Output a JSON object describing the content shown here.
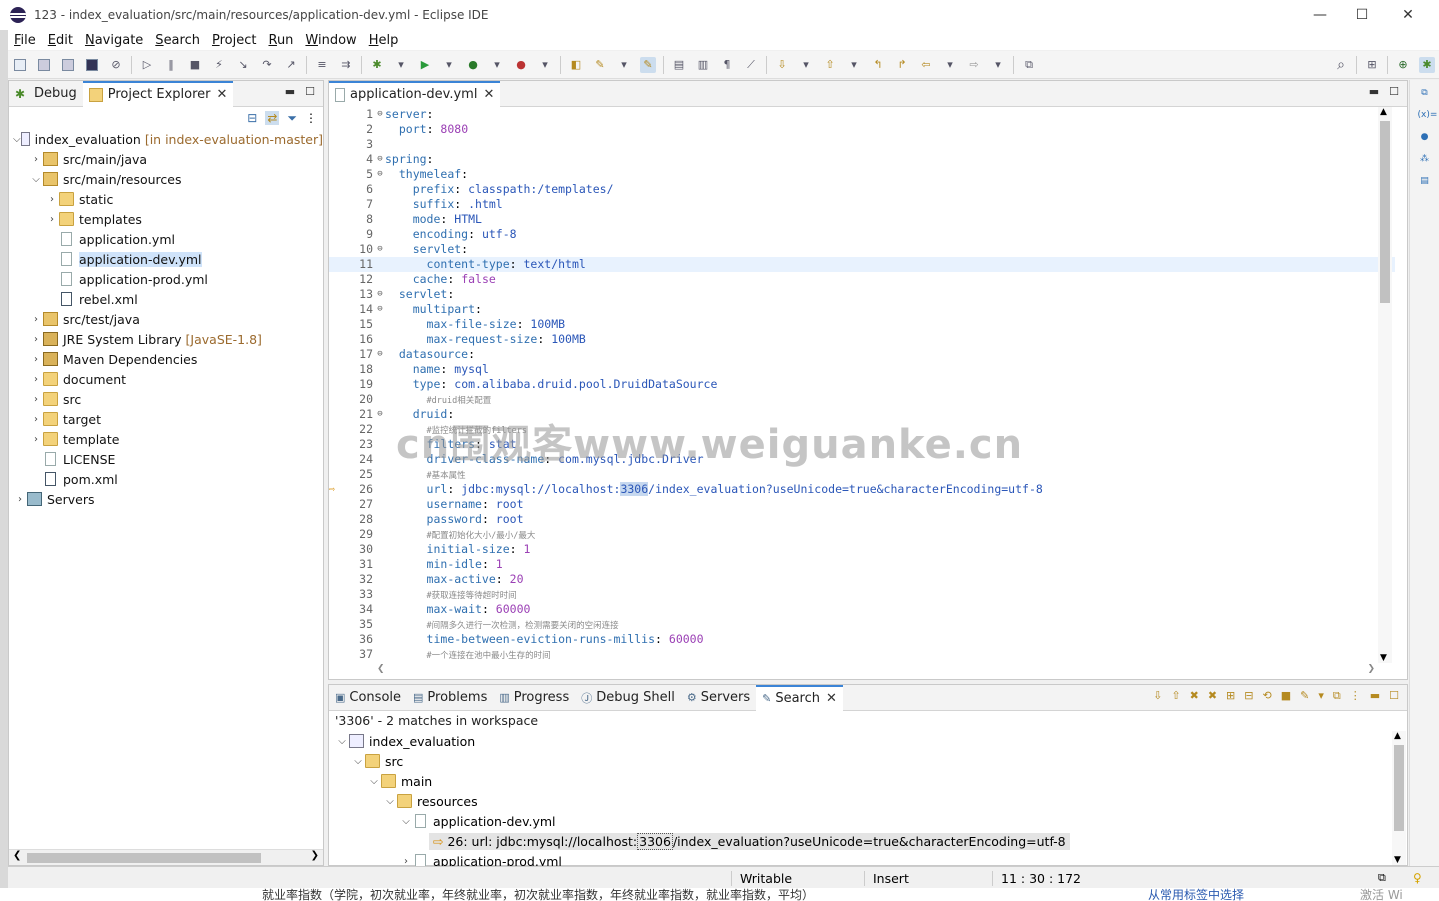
{
  "window": {
    "title": "123 - index_evaluation/src/main/resources/application-dev.yml - Eclipse IDE",
    "minimize": "—",
    "maximize": "☐",
    "close": "✕"
  },
  "menu": [
    "File",
    "Edit",
    "Navigate",
    "Search",
    "Project",
    "Run",
    "Window",
    "Help"
  ],
  "left_tabs": {
    "debug": "Debug",
    "explorer": "Project Explorer"
  },
  "tree": [
    {
      "label": "index_evaluation",
      "suffix": "[in index-evaluation-master]",
      "level": 0,
      "arrow": "v",
      "icon": "proj"
    },
    {
      "label": "src/main/java",
      "level": 1,
      "arrow": ">",
      "icon": "pkg"
    },
    {
      "label": "src/main/resources",
      "level": 1,
      "arrow": "v",
      "icon": "pkg"
    },
    {
      "label": "static",
      "level": 2,
      "arrow": ">",
      "icon": "folder"
    },
    {
      "label": "templates",
      "level": 2,
      "arrow": ">",
      "icon": "folder"
    },
    {
      "label": "application.yml",
      "level": 2,
      "arrow": "",
      "icon": "file"
    },
    {
      "label": "application-dev.yml",
      "level": 2,
      "arrow": "",
      "icon": "file",
      "selected": true
    },
    {
      "label": "application-prod.yml",
      "level": 2,
      "arrow": "",
      "icon": "file"
    },
    {
      "label": "rebel.xml",
      "level": 2,
      "arrow": "",
      "icon": "xml"
    },
    {
      "label": "src/test/java",
      "level": 1,
      "arrow": ">",
      "icon": "pkg"
    },
    {
      "label": "JRE System Library",
      "suffix": "[JavaSE-1.8]",
      "level": 1,
      "arrow": ">",
      "icon": "lib"
    },
    {
      "label": "Maven Dependencies",
      "level": 1,
      "arrow": ">",
      "icon": "lib"
    },
    {
      "label": "document",
      "level": 1,
      "arrow": ">",
      "icon": "folder"
    },
    {
      "label": "src",
      "level": 1,
      "arrow": ">",
      "icon": "folder"
    },
    {
      "label": "target",
      "level": 1,
      "arrow": ">",
      "icon": "folder"
    },
    {
      "label": "template",
      "level": 1,
      "arrow": ">",
      "icon": "folder"
    },
    {
      "label": "LICENSE",
      "level": 1,
      "arrow": "",
      "icon": "file"
    },
    {
      "label": "pom.xml",
      "level": 1,
      "arrow": "",
      "icon": "xml"
    },
    {
      "label": "Servers",
      "level": 0,
      "arrow": ">",
      "icon": "srv"
    }
  ],
  "editor": {
    "tab": "application-dev.yml",
    "highlight_line": 11,
    "lines": [
      {
        "n": "1",
        "f": "⊖",
        "t": [
          [
            "k",
            "server"
          ],
          [
            "p",
            ":"
          ]
        ]
      },
      {
        "n": "2",
        "t": [
          [
            "p",
            "  "
          ],
          [
            "k",
            "port"
          ],
          [
            "p",
            ": "
          ],
          [
            "n",
            "8080"
          ]
        ]
      },
      {
        "n": "3",
        "t": []
      },
      {
        "n": "4",
        "f": "⊖",
        "t": [
          [
            "k",
            "spring"
          ],
          [
            "p",
            ":"
          ]
        ]
      },
      {
        "n": "5",
        "f": "⊖",
        "t": [
          [
            "p",
            "  "
          ],
          [
            "k",
            "thymeleaf"
          ],
          [
            "p",
            ":"
          ]
        ]
      },
      {
        "n": "6",
        "t": [
          [
            "p",
            "    "
          ],
          [
            "k",
            "prefix"
          ],
          [
            "p",
            ": "
          ],
          [
            "v",
            "classpath:/templates/"
          ]
        ]
      },
      {
        "n": "7",
        "t": [
          [
            "p",
            "    "
          ],
          [
            "k",
            "suffix"
          ],
          [
            "p",
            ": "
          ],
          [
            "v",
            ".html"
          ]
        ]
      },
      {
        "n": "8",
        "t": [
          [
            "p",
            "    "
          ],
          [
            "k",
            "mode"
          ],
          [
            "p",
            ": "
          ],
          [
            "v",
            "HTML"
          ]
        ]
      },
      {
        "n": "9",
        "t": [
          [
            "p",
            "    "
          ],
          [
            "k",
            "encoding"
          ],
          [
            "p",
            ": "
          ],
          [
            "v",
            "utf-8"
          ]
        ]
      },
      {
        "n": "10",
        "f": "⊖",
        "t": [
          [
            "p",
            "    "
          ],
          [
            "k",
            "servlet"
          ],
          [
            "p",
            ":"
          ]
        ]
      },
      {
        "n": "11",
        "t": [
          [
            "p",
            "      "
          ],
          [
            "k",
            "content-type"
          ],
          [
            "p",
            ": "
          ],
          [
            "v",
            "text/html"
          ]
        ]
      },
      {
        "n": "12",
        "t": [
          [
            "p",
            "    "
          ],
          [
            "k",
            "cache"
          ],
          [
            "p",
            ": "
          ],
          [
            "n",
            "false"
          ]
        ]
      },
      {
        "n": "13",
        "f": "⊖",
        "t": [
          [
            "p",
            "  "
          ],
          [
            "k",
            "servlet"
          ],
          [
            "p",
            ":"
          ]
        ]
      },
      {
        "n": "14",
        "f": "⊖",
        "t": [
          [
            "p",
            "    "
          ],
          [
            "k",
            "multipart"
          ],
          [
            "p",
            ":"
          ]
        ]
      },
      {
        "n": "15",
        "t": [
          [
            "p",
            "      "
          ],
          [
            "k",
            "max-file-size"
          ],
          [
            "p",
            ": "
          ],
          [
            "v",
            "100MB"
          ]
        ]
      },
      {
        "n": "16",
        "t": [
          [
            "p",
            "      "
          ],
          [
            "k",
            "max-request-size"
          ],
          [
            "p",
            ": "
          ],
          [
            "v",
            "100MB"
          ]
        ]
      },
      {
        "n": "17",
        "f": "⊖",
        "t": [
          [
            "p",
            "  "
          ],
          [
            "k",
            "datasource"
          ],
          [
            "p",
            ":"
          ]
        ]
      },
      {
        "n": "18",
        "t": [
          [
            "p",
            "    "
          ],
          [
            "k",
            "name"
          ],
          [
            "p",
            ": "
          ],
          [
            "v",
            "mysql"
          ]
        ]
      },
      {
        "n": "19",
        "t": [
          [
            "p",
            "    "
          ],
          [
            "k",
            "type"
          ],
          [
            "p",
            ": "
          ],
          [
            "v",
            "com.alibaba.druid.pool.DruidDataSource"
          ]
        ]
      },
      {
        "n": "20",
        "t": [
          [
            "p",
            "      "
          ],
          [
            "c",
            "#druid相关配置"
          ]
        ]
      },
      {
        "n": "21",
        "f": "⊖",
        "t": [
          [
            "p",
            "    "
          ],
          [
            "k",
            "druid"
          ],
          [
            "p",
            ":"
          ]
        ]
      },
      {
        "n": "22",
        "t": [
          [
            "p",
            "      "
          ],
          [
            "c",
            "#监控统计拦截的filters"
          ]
        ]
      },
      {
        "n": "23",
        "t": [
          [
            "p",
            "      "
          ],
          [
            "k",
            "filters"
          ],
          [
            "p",
            ": "
          ],
          [
            "v",
            "stat"
          ]
        ]
      },
      {
        "n": "24",
        "t": [
          [
            "p",
            "      "
          ],
          [
            "k",
            "driver-class-name"
          ],
          [
            "p",
            ": "
          ],
          [
            "v",
            "com.mysql.jdbc.Driver"
          ]
        ]
      },
      {
        "n": "25",
        "t": [
          [
            "p",
            "      "
          ],
          [
            "c",
            "#基本属性"
          ]
        ]
      },
      {
        "n": "26",
        "mk": "⇨",
        "t": [
          [
            "p",
            "      "
          ],
          [
            "k",
            "url"
          ],
          [
            "p",
            ": "
          ],
          [
            "v",
            "jdbc:mysql://localhost:"
          ],
          [
            "s",
            "3306"
          ],
          [
            "v",
            "/index_evaluation?useUnicode=true&characterEncoding=utf-8"
          ]
        ]
      },
      {
        "n": "27",
        "t": [
          [
            "p",
            "      "
          ],
          [
            "k",
            "username"
          ],
          [
            "p",
            ": "
          ],
          [
            "v",
            "root"
          ]
        ]
      },
      {
        "n": "28",
        "t": [
          [
            "p",
            "      "
          ],
          [
            "k",
            "password"
          ],
          [
            "p",
            ": "
          ],
          [
            "v",
            "root"
          ]
        ]
      },
      {
        "n": "29",
        "t": [
          [
            "p",
            "      "
          ],
          [
            "c",
            "#配置初始化大小/最小/最大"
          ]
        ]
      },
      {
        "n": "30",
        "t": [
          [
            "p",
            "      "
          ],
          [
            "k",
            "initial-size"
          ],
          [
            "p",
            ": "
          ],
          [
            "n",
            "1"
          ]
        ]
      },
      {
        "n": "31",
        "t": [
          [
            "p",
            "      "
          ],
          [
            "k",
            "min-idle"
          ],
          [
            "p",
            ": "
          ],
          [
            "n",
            "1"
          ]
        ]
      },
      {
        "n": "32",
        "t": [
          [
            "p",
            "      "
          ],
          [
            "k",
            "max-active"
          ],
          [
            "p",
            ": "
          ],
          [
            "n",
            "20"
          ]
        ]
      },
      {
        "n": "33",
        "t": [
          [
            "p",
            "      "
          ],
          [
            "c",
            "#获取连接等待超时时间"
          ]
        ]
      },
      {
        "n": "34",
        "t": [
          [
            "p",
            "      "
          ],
          [
            "k",
            "max-wait"
          ],
          [
            "p",
            ": "
          ],
          [
            "n",
            "60000"
          ]
        ]
      },
      {
        "n": "35",
        "t": [
          [
            "p",
            "      "
          ],
          [
            "c",
            "#间隔多久进行一次检测，检测需要关闭的空闲连接"
          ]
        ]
      },
      {
        "n": "36",
        "t": [
          [
            "p",
            "      "
          ],
          [
            "k",
            "time-between-eviction-runs-millis"
          ],
          [
            "p",
            ": "
          ],
          [
            "n",
            "60000"
          ]
        ]
      },
      {
        "n": "37",
        "t": [
          [
            "p",
            "      "
          ],
          [
            "c",
            "#一个连接在池中最小生存的时间"
          ]
        ]
      }
    ]
  },
  "bottom_tabs": [
    "Console",
    "Problems",
    "Progress",
    "Debug Shell",
    "Servers",
    "Search"
  ],
  "search": {
    "header": "'3306' - 2 matches in workspace",
    "rows": [
      {
        "label": "index_evaluation",
        "level": 0,
        "arrow": "v",
        "icon": "proj"
      },
      {
        "label": "src",
        "level": 1,
        "arrow": "v",
        "icon": "folder"
      },
      {
        "label": "main",
        "level": 2,
        "arrow": "v",
        "icon": "folder"
      },
      {
        "label": "resources",
        "level": 3,
        "arrow": "v",
        "icon": "folder"
      },
      {
        "label": "application-dev.yml",
        "level": 4,
        "arrow": "v",
        "icon": "file"
      },
      {
        "label": "26: url: jdbc:mysql://localhost:",
        "mark": "3306",
        "after": "/index_evaluation?useUnicode=true&characterEncoding=utf-8",
        "level": 5,
        "arrow": "",
        "icon": "match"
      },
      {
        "label": "application-prod.yml",
        "level": 4,
        "arrow": ">",
        "icon": "file"
      }
    ]
  },
  "status": {
    "writable": "Writable",
    "insert": "Insert",
    "position": "11 : 30 : 172"
  },
  "taskbar": {
    "text": "就业率指数（学院，初次就业率，年终就业率，初次就业率指数，年终就业率指数，就业率指数，平均）",
    "link": "从常用标签中选择",
    "activate": "激活 Wi"
  },
  "watermark": "cn围观客www.weiguanke.cn",
  "colors": {
    "accent": "#3b84d6",
    "selection": "#cfe3fa",
    "keyword": "#2f6fb0",
    "number": "#9b40b5"
  }
}
